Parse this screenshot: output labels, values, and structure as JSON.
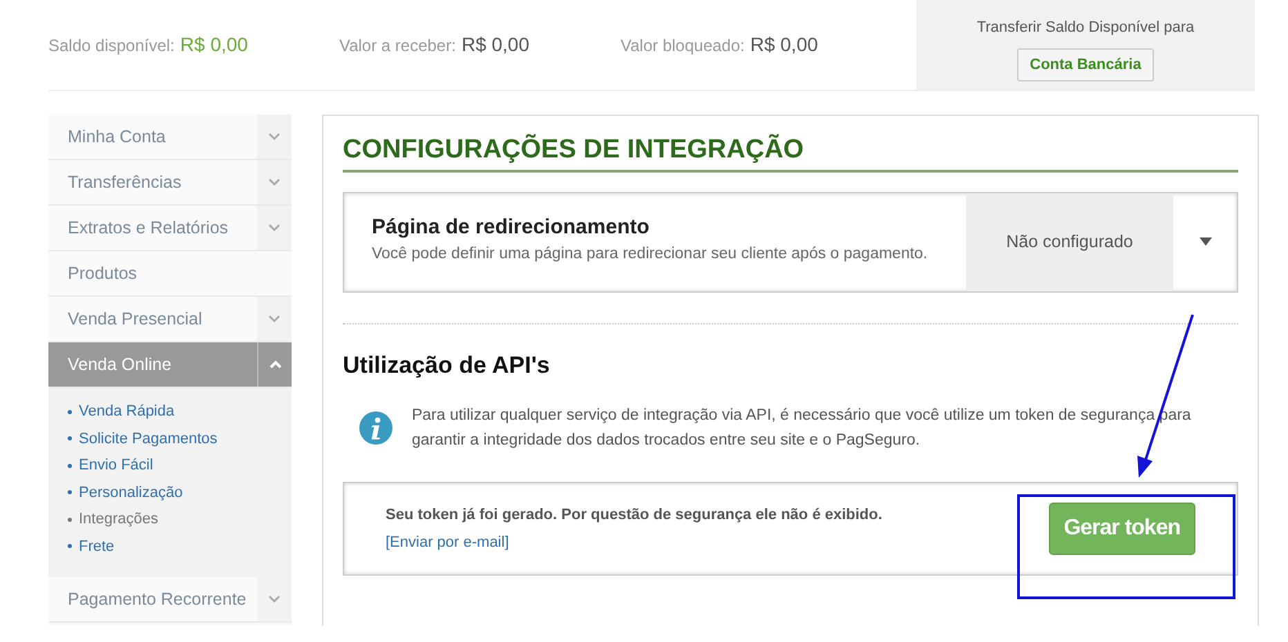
{
  "balances": [
    {
      "label": "Saldo disponível:",
      "value": "R$ 0,00",
      "kind": "positive"
    },
    {
      "label": "Valor a receber:",
      "value": "R$ 0,00",
      "kind": "neutral"
    },
    {
      "label": "Valor bloqueado:",
      "value": "R$ 0,00",
      "kind": "neutral"
    }
  ],
  "transfer": {
    "label": "Transferir Saldo Disponível para",
    "button": "Conta Bancária"
  },
  "sidebar": {
    "items": [
      {
        "label": "Minha Conta",
        "expandable": true,
        "expanded": false
      },
      {
        "label": "Transferências",
        "expandable": true,
        "expanded": false
      },
      {
        "label": "Extratos e Relatórios",
        "expandable": true,
        "expanded": false
      },
      {
        "label": "Produtos",
        "expandable": false,
        "expanded": false
      },
      {
        "label": "Venda Presencial",
        "expandable": true,
        "expanded": false
      },
      {
        "label": "Venda Online",
        "expandable": true,
        "expanded": true,
        "children": [
          {
            "label": "Venda Rápida",
            "selected": false
          },
          {
            "label": "Solicite Pagamentos",
            "selected": false
          },
          {
            "label": "Envio Fácil",
            "selected": false
          },
          {
            "label": "Personalização",
            "selected": false
          },
          {
            "label": "Integrações",
            "selected": true
          },
          {
            "label": "Frete",
            "selected": false
          }
        ]
      },
      {
        "label": "Pagamento Recorrente",
        "expandable": true,
        "expanded": false
      }
    ]
  },
  "main": {
    "title": "CONFIGURAÇÕES DE INTEGRAÇÃO",
    "redirect": {
      "title": "Página de redirecionamento",
      "description": "Você pode definir uma página para redirecionar seu cliente após o pagamento.",
      "value": "Não configurado"
    },
    "api": {
      "title": "Utilização de API's",
      "info": "Para utilizar qualquer serviço de integração via API, é necessário que você utilize um token de segurança para garantir a integridade dos dados trocados entre seu site e o PagSeguro.",
      "token_message": "Seu token já foi gerado. Por questão de segurança ele não é exibido.",
      "email_link": "[Enviar por e-mail]",
      "button": "Gerar token"
    }
  },
  "annotation": {
    "arrow": true,
    "highlight": true
  }
}
